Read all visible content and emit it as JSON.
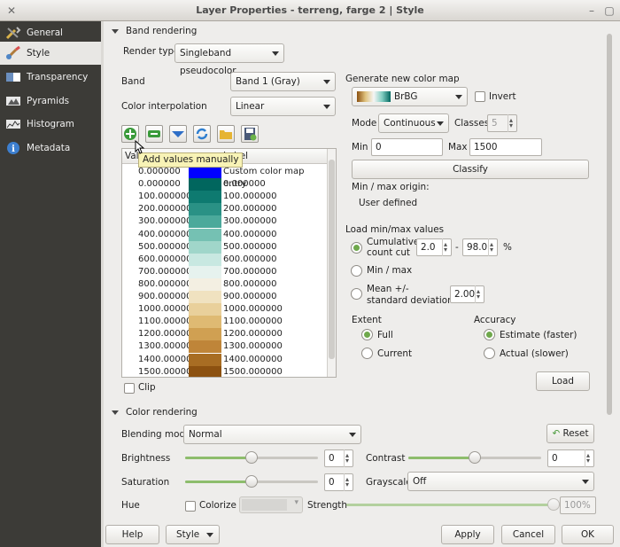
{
  "window": {
    "title": "Layer Properties - terreng, farge 2 | Style"
  },
  "sidebar": {
    "items": [
      {
        "label": "General",
        "icon": "wrench-icon"
      },
      {
        "label": "Style",
        "icon": "paintbrush-icon"
      },
      {
        "label": "Transparency",
        "icon": "transparency-icon"
      },
      {
        "label": "Pyramids",
        "icon": "pyramids-icon"
      },
      {
        "label": "Histogram",
        "icon": "histogram-icon"
      },
      {
        "label": "Metadata",
        "icon": "info-icon"
      }
    ]
  },
  "band_rendering": {
    "section_title": "Band rendering",
    "render_type_label": "Render type",
    "render_type_value": "Singleband pseudocolor",
    "band_label": "Band",
    "band_value": "Band 1 (Gray)",
    "interp_label": "Color interpolation",
    "interp_value": "Linear",
    "tooltip": "Add values manually",
    "table_headers": [
      "Value",
      "Label"
    ],
    "table_rows": [
      {
        "value": "0.000000",
        "color": "#0000ff",
        "label": "Custom color map entry"
      },
      {
        "value": "0.000000",
        "color": "#01665e",
        "label": "0.000000"
      },
      {
        "value": "100.000000",
        "color": "#0e7a70",
        "label": "100.000000"
      },
      {
        "value": "200.000000",
        "color": "#2a9185",
        "label": "200.000000"
      },
      {
        "value": "300.000000",
        "color": "#4ba99b",
        "label": "300.000000"
      },
      {
        "value": "400.000000",
        "color": "#75c1b3",
        "label": "400.000000"
      },
      {
        "value": "500.000000",
        "color": "#a0d6ca",
        "label": "500.000000"
      },
      {
        "value": "600.000000",
        "color": "#c8e8e1",
        "label": "600.000000"
      },
      {
        "value": "700.000000",
        "color": "#e6f2ee",
        "label": "700.000000"
      },
      {
        "value": "800.000000",
        "color": "#f3efe2",
        "label": "800.000000"
      },
      {
        "value": "900.000000",
        "color": "#f0e2c0",
        "label": "900.000000"
      },
      {
        "value": "1000.000000",
        "color": "#e9d09b",
        "label": "1000.000000"
      },
      {
        "value": "1100.000000",
        "color": "#dfba73",
        "label": "1100.000000"
      },
      {
        "value": "1200.000000",
        "color": "#d0a052",
        "label": "1200.000000"
      },
      {
        "value": "1300.000000",
        "color": "#bf8539",
        "label": "1300.000000"
      },
      {
        "value": "1400.000000",
        "color": "#a86d23",
        "label": "1400.000000"
      },
      {
        "value": "1500.000000",
        "color": "#8c5110",
        "label": "1500.000000"
      }
    ],
    "clip_label": "Clip",
    "new_map_label": "Generate new color map",
    "ramp_name": "BrBG",
    "invert_label": "Invert",
    "mode_label": "Mode",
    "mode_value": "Continuous",
    "classes_label": "Classes",
    "classes_value": "5",
    "min_label": "Min",
    "min_value": "0",
    "max_label": "Max",
    "max_value": "1500",
    "classify_label": "Classify",
    "origin_label": "Min / max origin:",
    "origin_value": "User defined",
    "load_label": "Load min/max values",
    "cumulative_label1": "Cumulative",
    "cumulative_label2": "count cut",
    "cum_low": "2.0",
    "cum_dash": "-",
    "cum_high": "98.0",
    "cum_pct": "%",
    "minmax_label": "Min / max",
    "mean_label1": "Mean +/-",
    "mean_label2": "standard deviation ×",
    "stddev_value": "2.00",
    "extent_label": "Extent",
    "extent_full": "Full",
    "extent_current": "Current",
    "accuracy_label": "Accuracy",
    "accuracy_estimate": "Estimate (faster)",
    "accuracy_actual": "Actual (slower)",
    "load_button": "Load"
  },
  "color_rendering": {
    "section_title": "Color rendering",
    "blending_label": "Blending mode",
    "blending_value": "Normal",
    "reset_label": "Reset",
    "brightness_label": "Brightness",
    "brightness_value": "0",
    "brightness_level": 0.5,
    "contrast_label": "Contrast",
    "contrast_value": "0",
    "contrast_level": 0.5,
    "saturation_label": "Saturation",
    "saturation_value": "0",
    "saturation_level": 0.5,
    "grayscale_label": "Grayscale",
    "grayscale_value": "Off",
    "hue_label": "Hue",
    "colorize_label": "Colorize",
    "strength_label": "Strength",
    "strength_value": "100%",
    "strength_level": 1.0
  },
  "footer": {
    "help": "Help",
    "style": "Style",
    "apply": "Apply",
    "cancel": "Cancel",
    "ok": "OK"
  }
}
